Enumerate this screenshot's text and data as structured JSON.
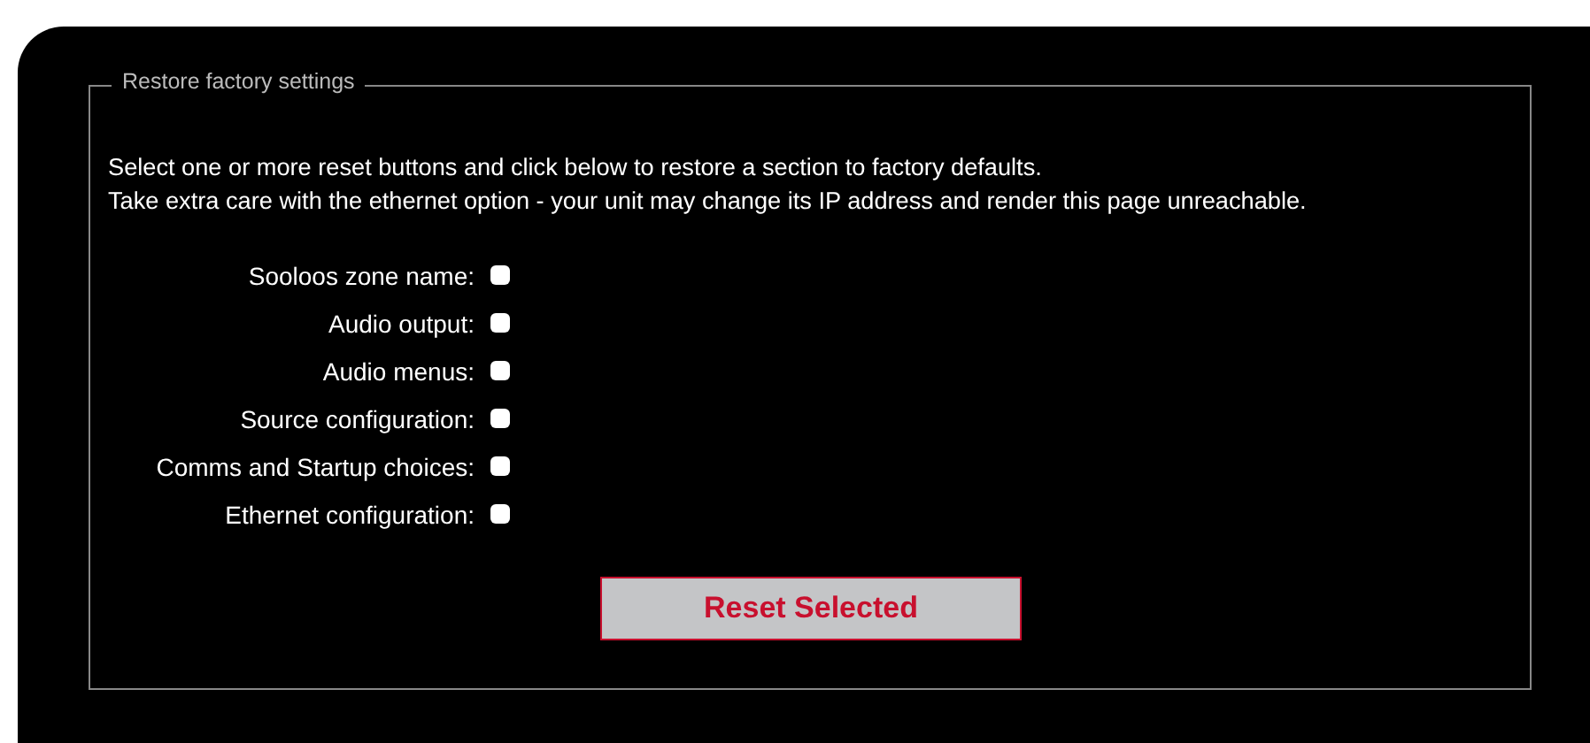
{
  "panel": {
    "legend": "Restore factory settings",
    "intro": [
      "Select one or more reset buttons and click below to restore a section to factory defaults.",
      "Take extra care with the ethernet option - your unit may change its IP address and render this page unreachable."
    ],
    "options": [
      {
        "label": "Sooloos zone name:",
        "checked": false
      },
      {
        "label": "Audio output:",
        "checked": false
      },
      {
        "label": "Audio menus:",
        "checked": false
      },
      {
        "label": "Source configuration:",
        "checked": false
      },
      {
        "label": "Comms and Startup choices:",
        "checked": false
      },
      {
        "label": "Ethernet configuration:",
        "checked": false
      }
    ],
    "button": "Reset Selected"
  }
}
